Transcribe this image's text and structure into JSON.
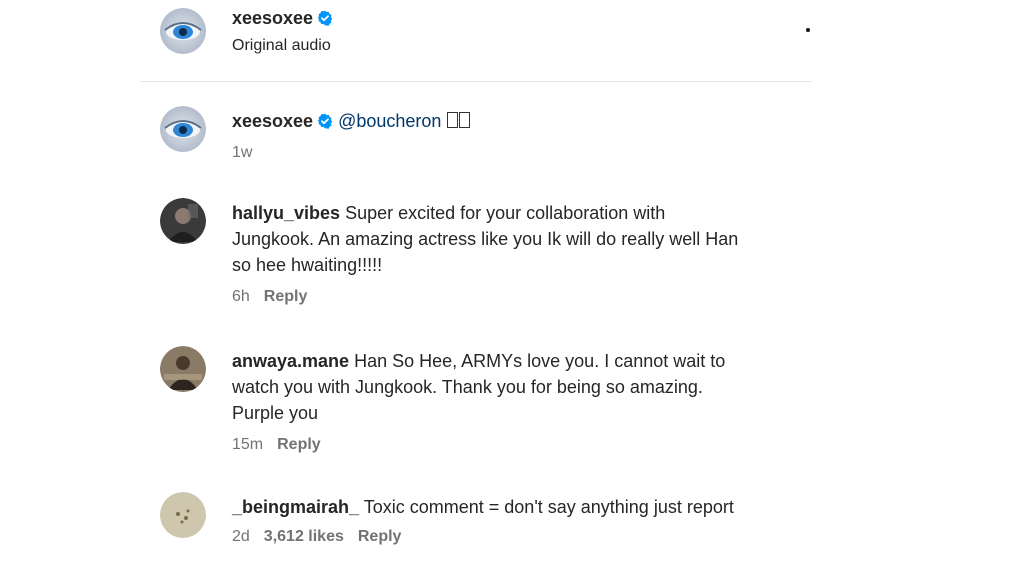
{
  "post_header": {
    "username": "xeesoxee",
    "verified": true,
    "audio_label": "Original audio",
    "more_icon": "more-dots-icon"
  },
  "caption": {
    "username": "xeesoxee",
    "verified": true,
    "mention": "@boucheron",
    "time": "1w"
  },
  "comments": [
    {
      "username": "hallyu_vibes",
      "lines": [
        "Super excited for your collaboration with",
        "Jungkook. An amazing actress like you Ik will do really well Han",
        "so hee hwaiting!!!!!"
      ],
      "time": "6h",
      "reply_label": "Reply"
    },
    {
      "username": "anwaya.mane",
      "lines": [
        "Han So Hee, ARMYs love you. I cannot wait to",
        "watch you with Jungkook. Thank you for being so amazing.",
        "Purple you"
      ],
      "time": "15m",
      "reply_label": "Reply"
    },
    {
      "username": "_beingmairah_",
      "lines": [
        "Toxic comment = don't say anything just report"
      ],
      "time": "2d",
      "likes": "3,612 likes",
      "reply_label": "Reply"
    }
  ],
  "colors": {
    "verified_blue": "#0095f6",
    "text": "#262626",
    "muted": "#737373",
    "mention": "#00376b"
  }
}
